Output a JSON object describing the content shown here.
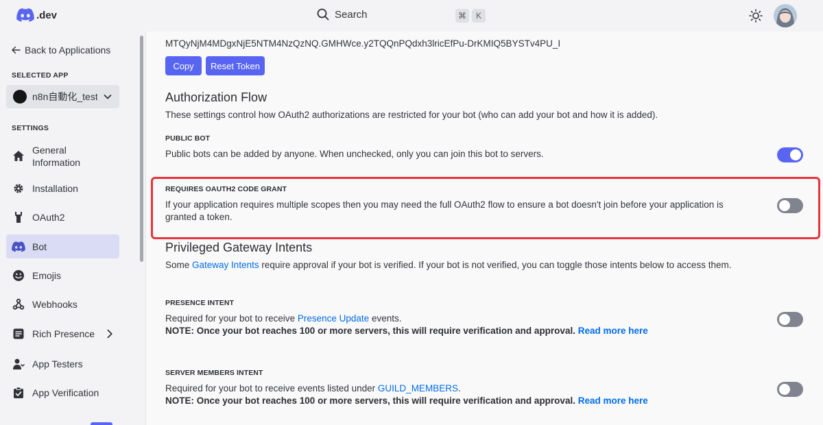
{
  "header": {
    "logo_text": ".dev",
    "search_label": "Search",
    "shortcut_keys": [
      "⌘",
      "K"
    ]
  },
  "sidebar": {
    "back_label": "Back to Applications",
    "selected_app_heading": "SELECTED APP",
    "selected_app_name": "n8n自動化_test",
    "settings_heading": "SETTINGS",
    "items": [
      {
        "label": "General Information",
        "icon": "home-icon"
      },
      {
        "label": "Installation",
        "icon": "gear-icon"
      },
      {
        "label": "OAuth2",
        "icon": "wrench-icon"
      },
      {
        "label": "Bot",
        "icon": "bot-icon",
        "active": true
      },
      {
        "label": "Emojis",
        "icon": "emoji-icon"
      },
      {
        "label": "Webhooks",
        "icon": "webhook-icon"
      },
      {
        "label": "Rich Presence",
        "icon": "rich-presence-icon"
      },
      {
        "label": "App Testers",
        "icon": "user-icon"
      },
      {
        "label": "App Verification",
        "icon": "clipboard-check-icon"
      }
    ]
  },
  "main": {
    "token": "MTQyNjM4MDgxNjE5NTM4NzQzNQ.GMHWce.y2TQQnPQdxh3lricEfPu-DrKMIQ5BYSTv4PU_I",
    "copy_label": "Copy",
    "reset_label": "Reset Token",
    "auth_flow": {
      "title": "Authorization Flow",
      "description": "These settings control how OAuth2 authorizations are restricted for your bot (who can add your bot and how it is added)."
    },
    "public_bot": {
      "heading": "PUBLIC BOT",
      "description": "Public bots can be added by anyone. When unchecked, only you can join this bot to servers.",
      "enabled": true
    },
    "code_grant": {
      "heading": "REQUIRES OAUTH2 CODE GRANT",
      "description_line1": "If your application requires multiple scopes then you may need the full OAuth2 flow to ensure a bot doesn't join before your application is",
      "description_line2": "granted a token.",
      "enabled": false
    },
    "intents": {
      "title": "Privileged Gateway Intents",
      "desc_prefix": "Some ",
      "desc_link": "Gateway Intents",
      "desc_suffix": " require approval if your bot is verified. If your bot is not verified, you can toggle those intents below to access them."
    },
    "presence": {
      "heading": "PRESENCE INTENT",
      "desc_prefix": "Required for your bot to receive ",
      "desc_link": "Presence Update",
      "desc_suffix": " events.",
      "note": "NOTE: Once your bot reaches 100 or more servers, this will require verification and approval.",
      "note_link": "Read more here",
      "enabled": false
    },
    "members": {
      "heading": "SERVER MEMBERS INTENT",
      "desc_prefix": "Required for your bot to receive events listed under ",
      "desc_link": "GUILD_MEMBERS",
      "desc_suffix": ".",
      "note": "NOTE: Once your bot reaches 100 or more servers, this will require verification and approval.",
      "note_link": "Read more here",
      "enabled": false
    }
  },
  "colors": {
    "accent": "#5865f2",
    "highlight": "#e8333a",
    "link": "#006ce7"
  }
}
